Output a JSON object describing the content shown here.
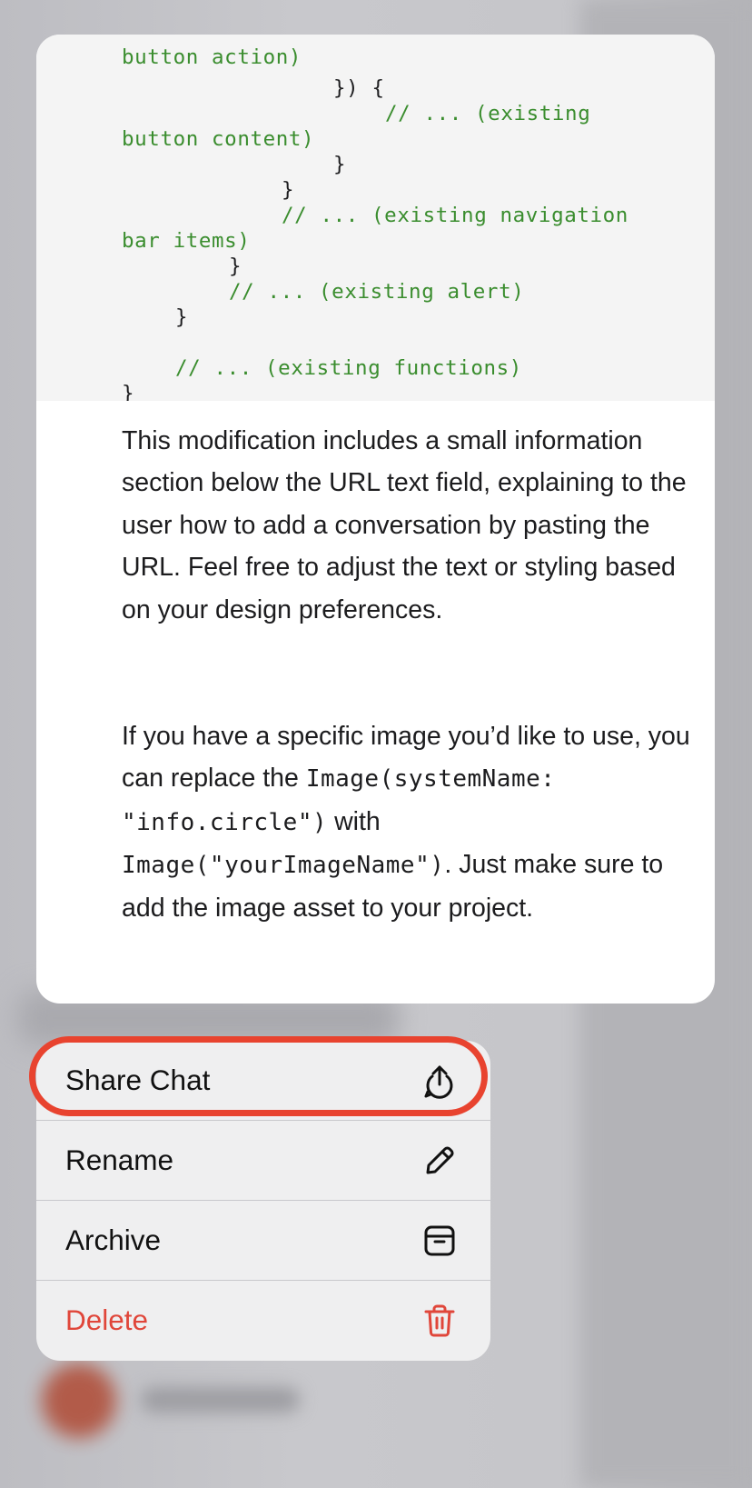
{
  "code": {
    "lines": [
      {
        "text": "button action)",
        "type": "comment-cut"
      },
      {
        "text": "}) {",
        "type": "code"
      },
      {
        "text": "// ... (existing",
        "type": "comment"
      },
      {
        "text": "button content)",
        "type": "comment"
      },
      {
        "text": "}",
        "type": "code"
      },
      {
        "text": "}",
        "type": "code"
      },
      {
        "text": "// ... (existing navigation",
        "type": "comment"
      },
      {
        "text": "bar items)",
        "type": "comment"
      },
      {
        "text": "}",
        "type": "code"
      },
      {
        "text": "// ... (existing alert)",
        "type": "comment"
      },
      {
        "text": "}",
        "type": "code"
      },
      {
        "text": "// ... (existing functions)",
        "type": "comment"
      },
      {
        "text": "}",
        "type": "code"
      }
    ]
  },
  "message": {
    "paragraph1": "This modification includes a small information section below the URL text field, explaining to the user how to add a conversation by pasting the URL. Feel free to adjust the text or styling based on your design preferences.",
    "p2_part1": "If you have a specific image you’d like to use, you can replace the",
    "p2_code1": "Image(systemName: \"info.circle\")",
    "p2_part2": "with",
    "p2_code2": "Image(\"yourImageName\")",
    "p2_part3": ". Just make sure to add the image asset to your project."
  },
  "menu": {
    "share_label": "Share Chat",
    "rename_label": "Rename",
    "archive_label": "Archive",
    "delete_label": "Delete"
  },
  "colors": {
    "accent_highlight": "#e8432f",
    "destructive": "#e0463a",
    "code_comment": "#3a8d2e"
  }
}
